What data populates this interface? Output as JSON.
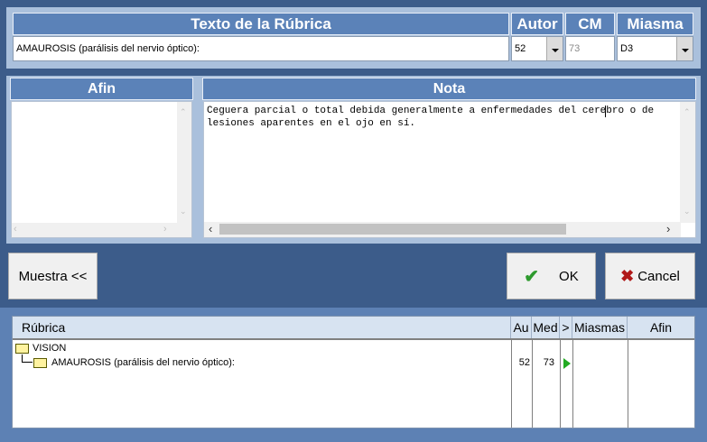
{
  "top": {
    "header_rubrica": "Texto de la Rúbrica",
    "header_autor": "Autor",
    "header_cm": "CM",
    "header_miasma": "Miasma",
    "rubrica_value": "AMAUROSIS (parálisis del nervio óptico):",
    "autor_value": "52",
    "cm_value": "73",
    "miasma_value": "D3"
  },
  "afin": {
    "header": "Afin"
  },
  "nota": {
    "header": "Nota",
    "line1": "Ceguera parcial o total debida generalmente a enfermedades del cerebro o de",
    "line2": "lesiones aparentes en el ojo en sí."
  },
  "buttons": {
    "muestra": "Muestra <<",
    "ok": "OK",
    "cancel": "Cancel"
  },
  "tree": {
    "columns": [
      "Rúbrica",
      "Au",
      "Med",
      ">",
      "Miasmas",
      "Afin"
    ],
    "root_label": "VISION",
    "child_label": "AMAUROSIS (parálisis del nervio óptico):",
    "child_au": "52",
    "child_med": "73"
  },
  "colors": {
    "header": "#5b82b8",
    "panel": "#aac0dc",
    "background": "#3c5c8a",
    "ok_check": "#2e9a2e",
    "cancel_x": "#b01818",
    "arrow": "#22aa22"
  }
}
